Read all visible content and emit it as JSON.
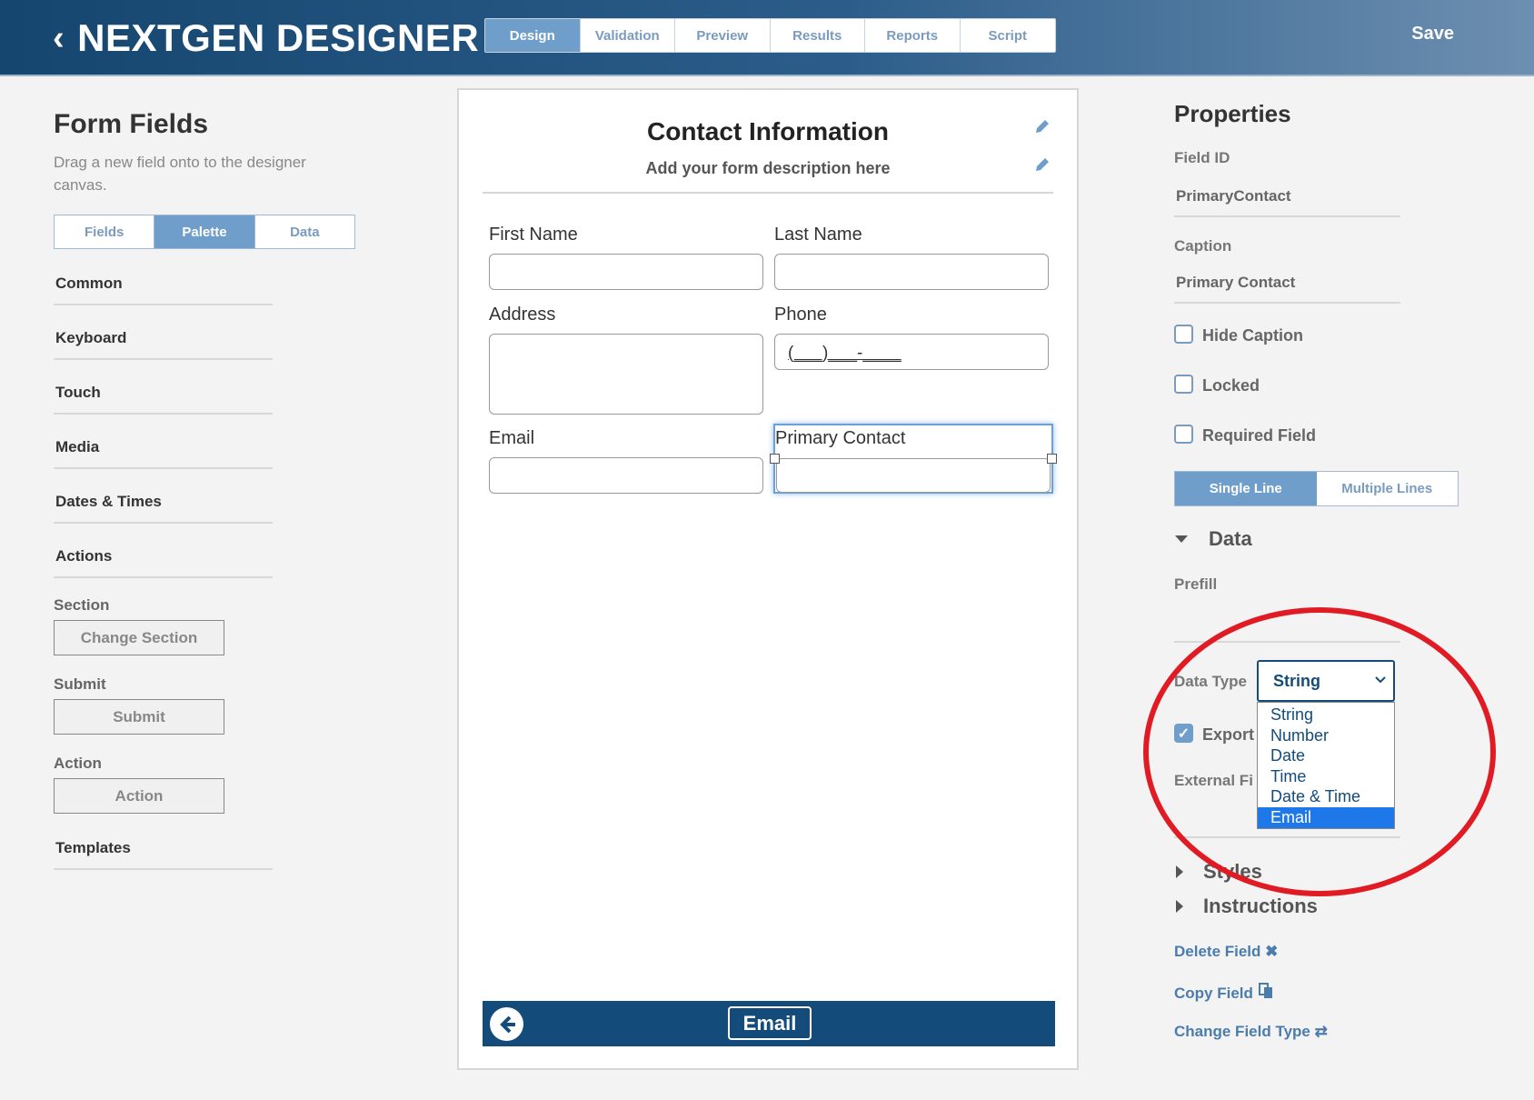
{
  "header": {
    "back_glyph": "‹",
    "brand": "NEXTGEN DESIGNER",
    "tabs": [
      {
        "label": "Design",
        "active": true
      },
      {
        "label": "Validation",
        "active": false
      },
      {
        "label": "Preview",
        "active": false
      },
      {
        "label": "Results",
        "active": false
      },
      {
        "label": "Reports",
        "active": false
      },
      {
        "label": "Script",
        "active": false
      }
    ],
    "save_label": "Save"
  },
  "left": {
    "title": "Form Fields",
    "description": "Drag a new field onto to the designer canvas.",
    "tabs": [
      {
        "label": "Fields",
        "active": false
      },
      {
        "label": "Palette",
        "active": true
      },
      {
        "label": "Data",
        "active": false
      }
    ],
    "categories": [
      "Common",
      "Keyboard",
      "Touch",
      "Media",
      "Dates & Times",
      "Actions"
    ],
    "groups": [
      {
        "label": "Section",
        "button": "Change Section"
      },
      {
        "label": "Submit",
        "button": "Submit"
      },
      {
        "label": "Action",
        "button": "Action"
      }
    ],
    "templates": "Templates"
  },
  "canvas": {
    "title": "Contact Information",
    "subtitle": "Add your form description here",
    "fields": {
      "first_name": "First Name",
      "last_name": "Last Name",
      "address": "Address",
      "phone": "Phone",
      "phone_mask": "(___)___-____",
      "email": "Email",
      "primary_contact": "Primary Contact"
    },
    "bottom_button": "Email"
  },
  "properties": {
    "title": "Properties",
    "field_id_label": "Field ID",
    "field_id_value": "PrimaryContact",
    "caption_label": "Caption",
    "caption_value": "Primary Contact",
    "hide_caption": "Hide Caption",
    "locked": "Locked",
    "required": "Required Field",
    "single_line": "Single Line",
    "multiple_lines": "Multiple Lines",
    "data_section": "Data",
    "prefill_label": "Prefill",
    "data_type_label": "Data Type",
    "data_type_value": "String",
    "data_type_options": [
      "String",
      "Number",
      "Date",
      "Time",
      "Date & Time",
      "Email"
    ],
    "export_label": "Export",
    "external_label": "External Fi",
    "styles_section": "Styles",
    "instructions_section": "Instructions",
    "delete_field": "Delete Field ✖",
    "copy_field": "Copy Field",
    "change_field_type": "Change Field Type ⇄"
  },
  "colors": {
    "brand": "#134c7a",
    "accent": "#6f9ecb",
    "annotation": "#e01b24"
  }
}
